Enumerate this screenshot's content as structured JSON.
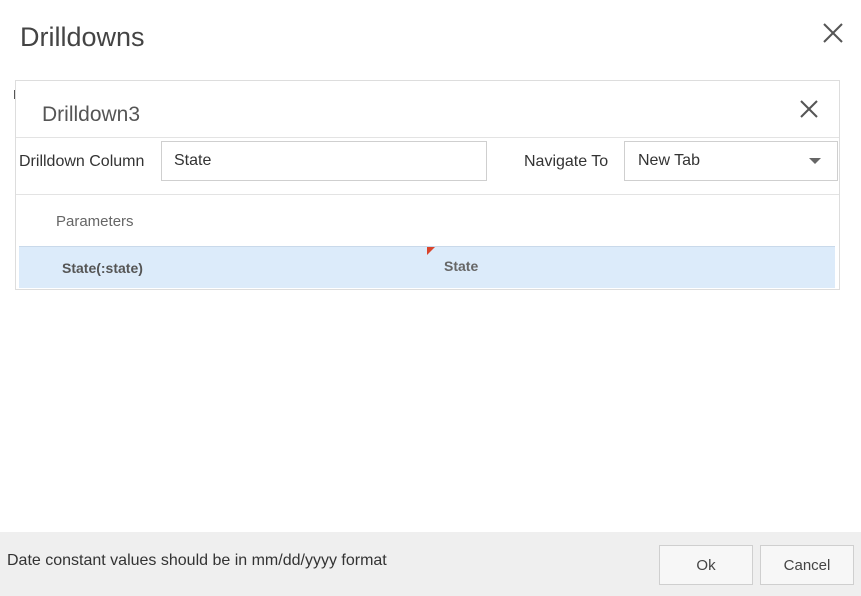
{
  "dialog": {
    "title": "Drilldowns",
    "close_icon": "close-icon"
  },
  "drilldown": {
    "title": "Drilldown3",
    "close_icon": "close-icon",
    "column_label": "Drilldown Column",
    "column_value": "State",
    "navigate_label": "Navigate To",
    "navigate_value": "New Tab",
    "parameters_label": "Parameters",
    "parameters": [
      {
        "name": "State(:state)",
        "value": "State"
      }
    ]
  },
  "footer": {
    "note": "Date constant values should be in mm/dd/yyyy format",
    "ok_label": "Ok",
    "cancel_label": "Cancel"
  },
  "colors": {
    "selected_row": "#dcebfa",
    "error_flag": "#d9442b",
    "footer_bg": "#efefef"
  }
}
